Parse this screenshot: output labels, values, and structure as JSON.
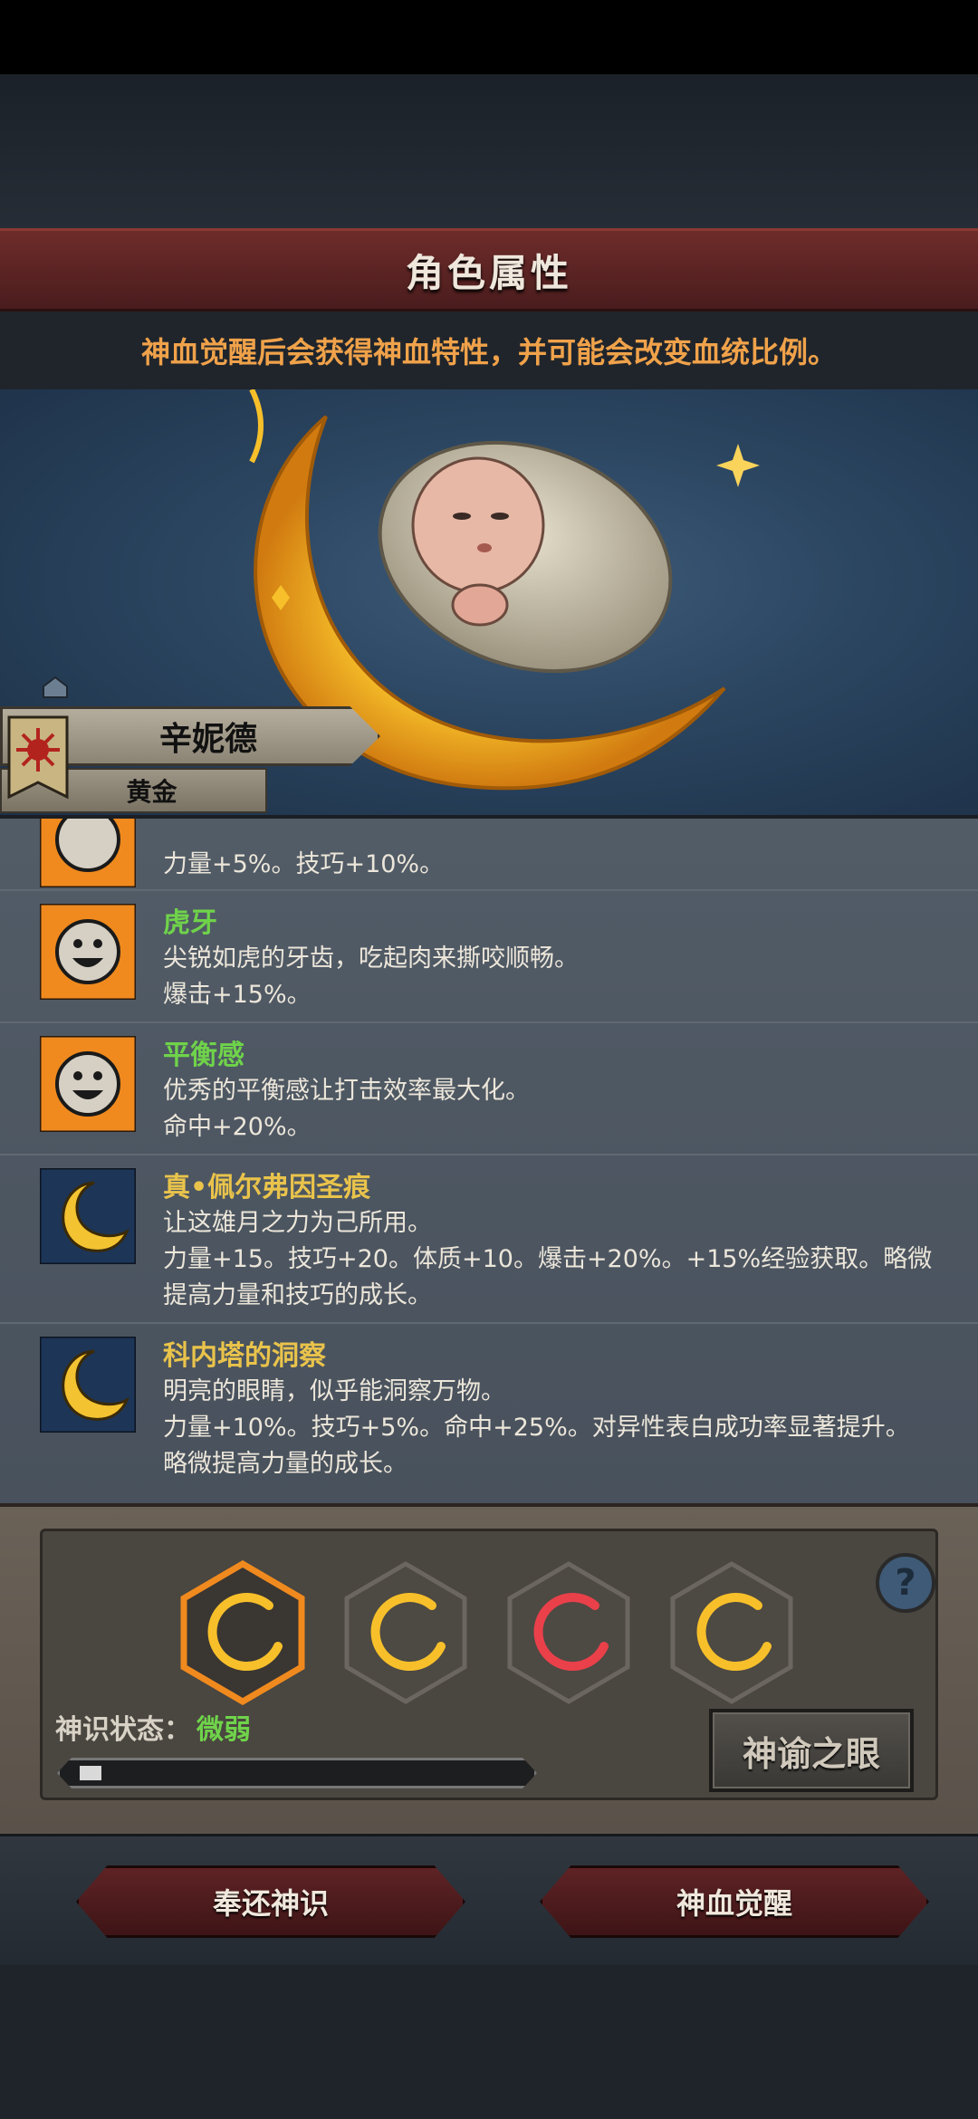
{
  "header": {
    "title": "角色属性",
    "subtitle": "神血觉醒后会获得神血特性，并可能会改变血统比例。"
  },
  "character": {
    "name": "辛妮德",
    "rank": "黄金"
  },
  "traits": [
    {
      "name": "",
      "lines": [
        "力量+5%。技巧+10%。"
      ],
      "icon": "sun-face-icon",
      "color": ""
    },
    {
      "name": "虎牙",
      "lines": [
        "尖锐如虎的牙齿，吃起肉来撕咬顺畅。",
        "爆击+15%。"
      ],
      "icon": "sun-face-icon",
      "color": "green"
    },
    {
      "name": "平衡感",
      "lines": [
        "优秀的平衡感让打击效率最大化。",
        "命中+20%。"
      ],
      "icon": "sun-face-icon",
      "color": "green"
    },
    {
      "name": "真•佩尔弗因圣痕",
      "lines": [
        "让这雄月之力为己所用。",
        "力量+15。技巧+20。体质+10。爆击+20%。+15%经验获取。略微",
        "提高力量和技巧的成长。"
      ],
      "icon": "moon-icon",
      "color": "gold"
    },
    {
      "name": "科内塔的洞察",
      "lines": [
        "明亮的眼睛，似乎能洞察万物。",
        "力量+10%。技巧+5%。命中+25%。对异性表白成功率显著提升。",
        "略微提高力量的成长。"
      ],
      "icon": "moon-icon",
      "color": "gold"
    }
  ],
  "slots": [
    {
      "icon": "crescent-icon",
      "tone": "gold",
      "selected": true
    },
    {
      "icon": "crescent-icon",
      "tone": "gold",
      "selected": false
    },
    {
      "icon": "crescent-icon",
      "tone": "red",
      "selected": false
    },
    {
      "icon": "crescent-icon",
      "tone": "gold",
      "selected": false
    }
  ],
  "status": {
    "label": "神识状态：",
    "value": "微弱",
    "progress": 0.05
  },
  "buttons": {
    "oracle": "神谕之眼",
    "return": "奉还神识",
    "awaken": "神血觉醒",
    "help": "?"
  },
  "colors": {
    "accent_gold": "#e9c34b",
    "accent_green": "#6fd34a",
    "accent_orange": "#f0a24a",
    "banner_red": "#5e2325"
  }
}
